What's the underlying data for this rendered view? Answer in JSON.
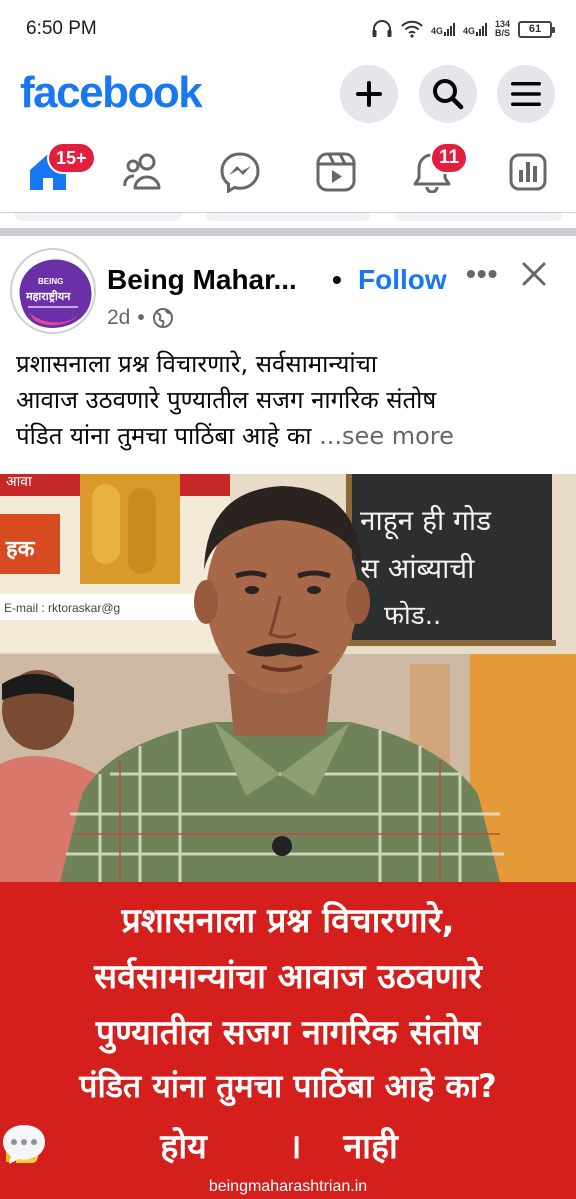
{
  "status_bar": {
    "time": "6:50 PM",
    "network_1": "4G",
    "network_2": "4G",
    "speed_value": "134",
    "speed_unit": "B/S",
    "battery": "61"
  },
  "header": {
    "logo": "facebook",
    "buttons": [
      {
        "name": "create",
        "icon": "plus-icon"
      },
      {
        "name": "search",
        "icon": "search-icon"
      },
      {
        "name": "menu",
        "icon": "hamburger-icon"
      }
    ]
  },
  "tabs": [
    {
      "name": "home",
      "icon": "home-icon",
      "badge": "15+"
    },
    {
      "name": "friends",
      "icon": "friends-icon",
      "badge": ""
    },
    {
      "name": "messenger",
      "icon": "messenger-icon",
      "badge": ""
    },
    {
      "name": "video",
      "icon": "video-icon",
      "badge": ""
    },
    {
      "name": "notifications",
      "icon": "bell-icon",
      "badge": "11"
    },
    {
      "name": "dashboard",
      "icon": "dashboard-icon",
      "badge": ""
    }
  ],
  "post": {
    "page_name": "Being Mahar...",
    "separator": "•",
    "follow_label": "Follow",
    "more_label": "•••",
    "time": "2d",
    "meta_dot": "•",
    "avatar_text_top": "BEING",
    "avatar_text_main": "महाराष्ट्रीयन",
    "caption_lines": [
      "प्रशासनाला प्रश्न विचारणारे, सर्वसामान्यांचा",
      "आवाज उठवणारे पुण्यातील सजग नागरिक संतोष",
      "पंडित यांना तुमचा पाठिंबा आहे का "
    ],
    "see_more": "...see more",
    "image": {
      "board_text_1": "नाहून ही गोड",
      "board_text_2": "स आंब्याची",
      "board_text_3": "फोड..",
      "email_text": "E-mail : rktoraskar@g",
      "banner_lines": [
        "प्रशासनाला प्रश्न विचारणारे,",
        "सर्वसामान्यांचा आवाज उठवणारे",
        "पुण्यातील सजग नागरिक संतोष",
        "पंडित यांना तुमचा पाठिंबा आहे का?"
      ],
      "poll_yes": "होय",
      "poll_sep": "।",
      "poll_no": "नाही",
      "site": "beingmaharashtrian.in"
    }
  },
  "colors": {
    "brand": "#1877f2",
    "badge": "#e41e3f",
    "banner": "#d51f1d",
    "secondary_text": "#65676b"
  }
}
